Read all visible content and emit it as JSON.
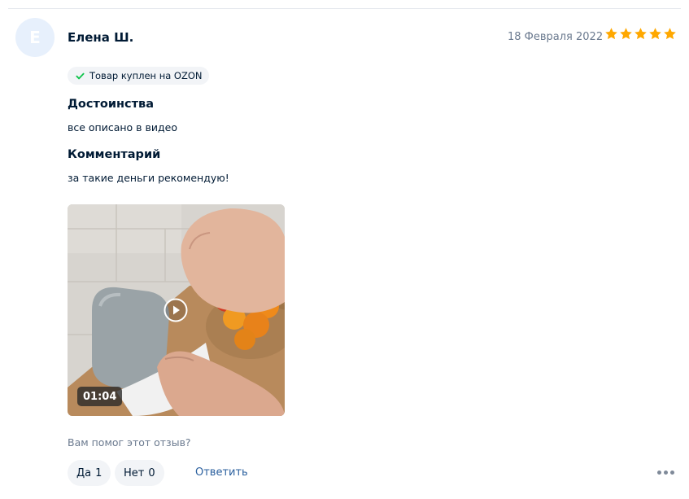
{
  "review": {
    "author": {
      "initial": "Е",
      "name": "Елена Ш."
    },
    "date": "18 Февраля 2022",
    "rating": 5,
    "rating_max": 5,
    "purchase_badge": "Товар куплен на OZON",
    "pros_title": "Достоинства",
    "pros_text": "все описано в видео",
    "comment_title": "Комментарий",
    "comment_text": "за такие деньги рекомендую!",
    "video": {
      "duration": "01:04"
    },
    "helpful": {
      "question": "Вам помог этот отзыв?",
      "yes_label": "Да",
      "yes_count": "1",
      "no_label": "Нет",
      "no_count": "0"
    },
    "reply_label": "Ответить"
  },
  "colors": {
    "star": "#ffa800",
    "accent_link": "#2a5f9e",
    "check": "#10c44c",
    "avatar_bg": "#e7f0fc"
  },
  "icons": {
    "star": "star-icon",
    "check": "check-icon",
    "play": "play-icon",
    "more": "more-dots-icon"
  }
}
